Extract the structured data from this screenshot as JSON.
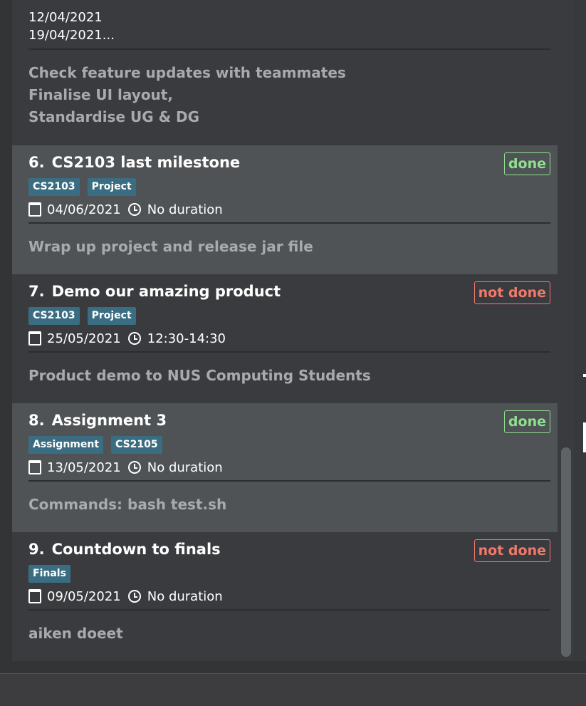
{
  "partial_card": {
    "dates": [
      "12/04/2021",
      "19/04/2021..."
    ],
    "description_lines": [
      "Check feature updates with teammates",
      "Finalise UI layout,",
      "Standardise UG & DG"
    ]
  },
  "tasks": [
    {
      "index": "6.",
      "title": "CS2103 last milestone",
      "status": "done",
      "tags": [
        "CS2103",
        "Project"
      ],
      "date": "04/06/2021",
      "duration": "No duration",
      "description": "Wrap up project and release jar file"
    },
    {
      "index": "7.",
      "title": "Demo our amazing product",
      "status": "not done",
      "tags": [
        "CS2103",
        "Project"
      ],
      "date": "25/05/2021",
      "duration": "12:30-14:30",
      "description": "Product demo to NUS Computing Students"
    },
    {
      "index": "8.",
      "title": "Assignment 3",
      "status": "done",
      "tags": [
        "Assignment",
        "CS2105"
      ],
      "date": "13/05/2021",
      "duration": "No duration",
      "description": "Commands: bash test.sh"
    },
    {
      "index": "9.",
      "title": "Countdown to finals",
      "status": "not done",
      "tags": [
        "Finals"
      ],
      "date": "09/05/2021",
      "duration": "No duration",
      "description": "aiken doeet"
    }
  ],
  "colors": {
    "done": "#8fe08f",
    "not_done": "#f07a6b",
    "tag": "#3b6d82",
    "card_dark": "#3a3b3e",
    "card_light": "#4f5356"
  },
  "icons": {
    "date": "calendar-icon",
    "duration": "clock-icon"
  }
}
